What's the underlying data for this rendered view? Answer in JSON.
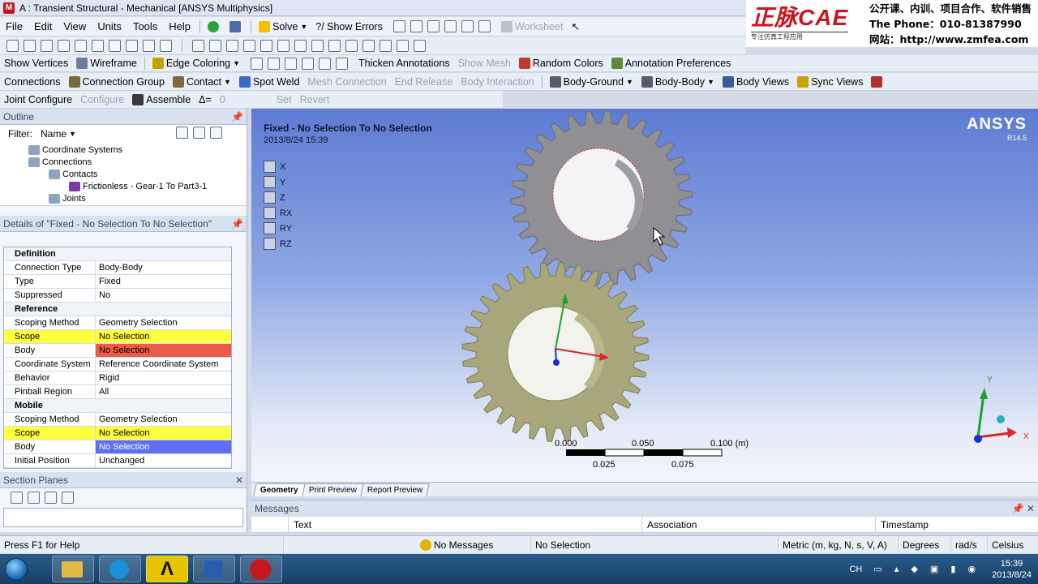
{
  "window": {
    "title": "A : Transient Structural - Mechanical [ANSYS Multiphysics]",
    "logo": "M"
  },
  "brand": {
    "logo_text": "正脉CAE",
    "tagline": "专注仿真工程应用",
    "line1": "公开课、内训、项目合作、软件销售",
    "line2": "The Phone：010-81387990",
    "line3": "网站：http://www.zmfea.com"
  },
  "menu": [
    "File",
    "Edit",
    "View",
    "Units",
    "Tools",
    "Help"
  ],
  "toolbar1": {
    "solve": "Solve",
    "show_errors": "?/ Show Errors",
    "worksheet": "Worksheet"
  },
  "toolbar2": {
    "show_vertices": "Show Vertices",
    "wireframe": "Wireframe",
    "edge_coloring": "Edge Coloring",
    "thicken_annotations": "Thicken Annotations",
    "show_mesh": "Show Mesh",
    "random_colors": "Random Colors",
    "annotation_preferences": "Annotation Preferences"
  },
  "toolbar3": {
    "connections": "Connections",
    "connection_group": "Connection Group",
    "contact": "Contact",
    "spot_weld": "Spot Weld",
    "mesh_connection": "Mesh Connection",
    "end_release": "End Release",
    "body_interaction": "Body Interaction",
    "body_ground": "Body-Ground",
    "body_body": "Body-Body",
    "body_views": "Body Views",
    "sync_views": "Sync Views"
  },
  "toolbar4": {
    "joint_configure": "Joint Configure",
    "configure": "Configure",
    "assemble": "Assemble",
    "delta": "Δ=",
    "delta_value": "0",
    "set": "Set",
    "revert": "Revert"
  },
  "outline": {
    "title": "Outline",
    "filter_label": "Filter:",
    "filter_value": "Name",
    "nodes": [
      "Coordinate Systems",
      "Connections",
      "Contacts",
      "Frictionless - Gear-1 To Part3-1",
      "Joints"
    ]
  },
  "details": {
    "title": "Details of \"Fixed - No Selection To No Selection\"",
    "rows": [
      {
        "k": "Definition",
        "v": "",
        "sec": true
      },
      {
        "k": "Connection Type",
        "v": "Body-Body"
      },
      {
        "k": "Type",
        "v": "Fixed"
      },
      {
        "k": "Suppressed",
        "v": "No"
      },
      {
        "k": "Reference",
        "v": "",
        "sec": true
      },
      {
        "k": "Scoping Method",
        "v": "Geometry Selection"
      },
      {
        "k": "Scope",
        "v": "No Selection",
        "style": "yel"
      },
      {
        "k": "Body",
        "v": "No Selection",
        "style": "red"
      },
      {
        "k": "Coordinate System",
        "v": "Reference Coordinate System"
      },
      {
        "k": "Behavior",
        "v": "Rigid"
      },
      {
        "k": "Pinball Region",
        "v": "All"
      },
      {
        "k": "Mobile",
        "v": "",
        "sec": true
      },
      {
        "k": "Scoping Method",
        "v": "Geometry Selection"
      },
      {
        "k": "Scope",
        "v": "No Selection",
        "style": "yel"
      },
      {
        "k": "Body",
        "v": "No Selection",
        "style": "blu"
      },
      {
        "k": "Initial Position",
        "v": "Unchanged"
      }
    ]
  },
  "section_planes": {
    "title": "Section Planes"
  },
  "viewport": {
    "title": "Fixed - No Selection To No Selection",
    "date": "2013/8/24 15:39",
    "brand": "ANSYS",
    "version": "R14.5",
    "axes": [
      "X",
      "Y",
      "Z",
      "RX",
      "RY",
      "RZ"
    ],
    "scale_top": [
      "0.000",
      "0.050",
      "0.100 (m)"
    ],
    "scale_bottom": [
      "0.025",
      "0.075"
    ],
    "triad": {
      "x": "X",
      "y": "Y"
    },
    "colors": {
      "top_gear": "#8f8f94",
      "bottom_gear": "#a8a77c"
    }
  },
  "tabs": [
    "Geometry",
    "Print Preview",
    "Report Preview"
  ],
  "messages": {
    "title": "Messages",
    "cols": [
      "Text",
      "Association",
      "Timestamp"
    ]
  },
  "status": {
    "help": "Press F1 for Help",
    "messages": "No Messages",
    "selection": "No Selection",
    "units": "Metric (m, kg, N, s, V, A)",
    "angle": "Degrees",
    "rate": "rad/s",
    "temp": "Celsius"
  },
  "taskbar": {
    "time": "15:39",
    "date": "2013/8/24",
    "lang": "CH"
  }
}
